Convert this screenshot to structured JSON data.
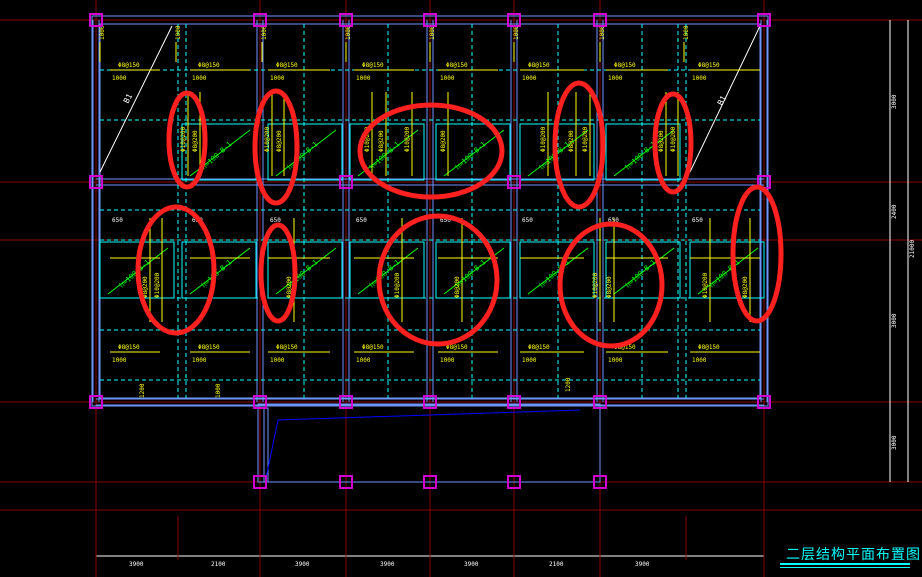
{
  "title": "二层结构平面布置图",
  "dimensions": {
    "bottom_spans": [
      "3900",
      "2100",
      "3900",
      "3900",
      "3900",
      "2100",
      "3900"
    ],
    "right_spans": [
      "3000",
      "2400",
      "3000",
      "3000"
    ],
    "right_total": "21000"
  },
  "annotations": {
    "beam_label": "B1",
    "rebar_top": "Φ8@150",
    "rebar_left": "Φ8@200",
    "rebar_mid": "Φ10@200",
    "slab_note": "h=100 B-1",
    "dim_1000": "1000",
    "dim_650": "650",
    "dim_1200": "1200"
  },
  "colors": {
    "background": "#000000",
    "axis": "#8a0000",
    "beam": "#6f95ff",
    "dashed_beam": "#00ffff",
    "rebar": "#ffff00",
    "column": "#d000d0",
    "text_green": "#00ff00",
    "marker": "#ff2020",
    "white": "#ffffff",
    "stair_line": "#0000ff"
  }
}
